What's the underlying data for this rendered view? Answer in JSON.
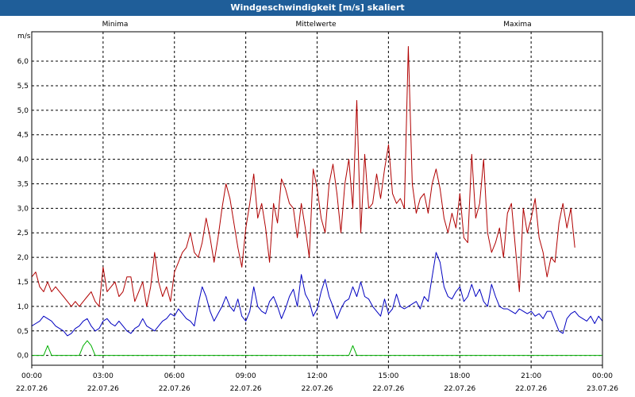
{
  "window": {
    "title": "Windgeschwindigkeit [m/s] skaliert"
  },
  "colors": {
    "min": "#00b000",
    "mean": "#0000c0",
    "max": "#b00000",
    "titlebar": "#1f5e99",
    "grid": "#000000"
  },
  "chart_data": {
    "type": "line",
    "title": "Windgeschwindigkeit [m/s] skaliert",
    "ylabel": "m/s",
    "xlabel": "",
    "ylim": [
      -0.2,
      6.6
    ],
    "xlim": [
      0,
      24
    ],
    "yticks": [
      0.0,
      0.5,
      1.0,
      1.5,
      2.0,
      2.5,
      3.0,
      3.5,
      4.0,
      4.5,
      5.0,
      5.5,
      6.0
    ],
    "ytick_labels": [
      "0,0",
      "0,5",
      "1,0",
      "1,5",
      "2,0",
      "2,5",
      "3,0",
      "3,5",
      "4,0",
      "4,5",
      "5,0",
      "5,5",
      "6,0"
    ],
    "xticks": [
      {
        "hour": 0,
        "time": "00:00",
        "date": "22.07.26"
      },
      {
        "hour": 3,
        "time": "03:00",
        "date": "22.07.26"
      },
      {
        "hour": 6,
        "time": "06:00",
        "date": "22.07.26"
      },
      {
        "hour": 9,
        "time": "09:00",
        "date": "22.07.26"
      },
      {
        "hour": 12,
        "time": "12:00",
        "date": "22.07.26"
      },
      {
        "hour": 15,
        "time": "15:00",
        "date": "22.07.26"
      },
      {
        "hour": 18,
        "time": "18:00",
        "date": "22.07.26"
      },
      {
        "hour": 21,
        "time": "21:00",
        "date": "22.07.26"
      },
      {
        "hour": 24,
        "time": "00:00",
        "date": "23.07.26"
      }
    ],
    "grid": true,
    "x_step_hours": 0.1667,
    "series": [
      {
        "name": "Minima",
        "key": "min",
        "values": [
          0.0,
          0.0,
          0.0,
          0.0,
          0.2,
          0.0,
          0.0,
          0.0,
          0.0,
          0.0,
          0.0,
          0.0,
          0.0,
          0.2,
          0.3,
          0.2,
          0.0,
          0.0,
          0.0,
          0.0,
          0.0,
          0.0,
          0.0,
          0.0,
          0.0,
          0.0,
          0.0,
          0.0,
          0.0,
          0.0,
          0.0,
          0.0,
          0.0,
          0.0,
          0.0,
          0.0,
          0.0,
          0.0,
          0.0,
          0.0,
          0.0,
          0.0,
          0.0,
          0.0,
          0.0,
          0.0,
          0.0,
          0.0,
          0.0,
          0.0,
          0.0,
          0.0,
          0.0,
          0.0,
          0.0,
          0.0,
          0.0,
          0.0,
          0.0,
          0.0,
          0.0,
          0.0,
          0.0,
          0.0,
          0.0,
          0.0,
          0.0,
          0.0,
          0.0,
          0.0,
          0.0,
          0.0,
          0.0,
          0.0,
          0.0,
          0.0,
          0.0,
          0.0,
          0.0,
          0.0,
          0.0,
          0.2,
          0.0,
          0.0,
          0.0,
          0.0,
          0.0,
          0.0,
          0.0,
          0.0,
          0.0,
          0.0,
          0.0,
          0.0,
          0.0,
          0.0,
          0.0,
          0.0,
          0.0,
          0.0,
          0.0,
          0.0,
          0.0,
          0.0,
          0.0,
          0.0,
          0.0,
          0.0,
          0.0,
          0.0,
          0.0,
          0.0,
          0.0,
          0.0,
          0.0,
          0.0,
          0.0,
          0.0,
          0.0,
          0.0,
          0.0,
          0.0,
          0.0,
          0.0,
          0.0,
          0.0,
          0.0,
          0.0,
          0.0,
          0.0,
          0.0,
          0.0,
          0.0,
          0.0,
          0.0,
          0.0,
          0.0,
          0.0,
          0.0,
          0.0,
          0.0,
          0.0,
          0.0,
          0.0,
          0.0
        ]
      },
      {
        "name": "Mittelwerte",
        "key": "mean",
        "values": [
          0.6,
          0.65,
          0.7,
          0.8,
          0.75,
          0.7,
          0.6,
          0.55,
          0.5,
          0.4,
          0.45,
          0.55,
          0.6,
          0.7,
          0.75,
          0.6,
          0.5,
          0.55,
          0.7,
          0.75,
          0.65,
          0.6,
          0.7,
          0.6,
          0.5,
          0.45,
          0.55,
          0.6,
          0.75,
          0.6,
          0.55,
          0.5,
          0.6,
          0.7,
          0.75,
          0.85,
          0.8,
          0.95,
          0.85,
          0.75,
          0.7,
          0.6,
          1.05,
          1.4,
          1.2,
          0.9,
          0.7,
          0.85,
          1.0,
          1.2,
          1.0,
          0.9,
          1.15,
          0.8,
          0.7,
          0.9,
          1.4,
          1.0,
          0.9,
          0.85,
          1.1,
          1.2,
          1.0,
          0.75,
          0.95,
          1.2,
          1.35,
          1.0,
          1.65,
          1.25,
          1.1,
          0.8,
          0.95,
          1.3,
          1.55,
          1.2,
          1.0,
          0.75,
          0.95,
          1.1,
          1.15,
          1.4,
          1.2,
          1.5,
          1.2,
          1.15,
          1.0,
          0.9,
          0.8,
          1.15,
          0.85,
          0.95,
          1.25,
          1.0,
          0.95,
          1.0,
          1.05,
          1.1,
          0.95,
          1.2,
          1.1,
          1.6,
          2.1,
          1.9,
          1.4,
          1.2,
          1.15,
          1.3,
          1.4,
          1.1,
          1.2,
          1.45,
          1.2,
          1.35,
          1.1,
          1.0,
          1.45,
          1.2,
          1.0,
          0.95,
          0.95,
          0.9,
          0.85,
          0.95,
          0.9,
          0.85,
          0.9,
          0.8,
          0.85,
          0.75,
          0.9,
          0.9,
          0.7,
          0.5,
          0.45,
          0.75,
          0.85,
          0.9,
          0.8,
          0.75,
          0.7,
          0.8,
          0.65,
          0.8,
          0.7,
          0.9,
          0.85,
          0.95,
          0.9
        ]
      },
      {
        "name": "Maxima",
        "key": "max",
        "values": [
          1.6,
          1.7,
          1.4,
          1.3,
          1.5,
          1.3,
          1.4,
          1.3,
          1.2,
          1.1,
          1.0,
          1.1,
          1.0,
          1.1,
          1.2,
          1.3,
          1.1,
          1.0,
          1.8,
          1.3,
          1.4,
          1.5,
          1.2,
          1.3,
          1.6,
          1.6,
          1.1,
          1.3,
          1.5,
          1.0,
          1.4,
          2.1,
          1.5,
          1.2,
          1.4,
          1.1,
          1.7,
          1.9,
          2.1,
          2.2,
          2.5,
          2.1,
          2.0,
          2.3,
          2.8,
          2.4,
          1.9,
          2.4,
          3.0,
          3.5,
          3.2,
          2.7,
          2.2,
          1.8,
          2.6,
          3.1,
          3.7,
          2.8,
          3.1,
          2.6,
          1.9,
          3.1,
          2.7,
          3.6,
          3.4,
          3.1,
          3.0,
          2.4,
          3.1,
          2.6,
          2.0,
          3.8,
          3.4,
          2.8,
          2.5,
          3.5,
          3.9,
          3.3,
          2.5,
          3.5,
          4.0,
          3.0,
          5.2,
          2.5,
          4.1,
          3.0,
          3.1,
          3.7,
          3.2,
          3.8,
          4.3,
          3.3,
          3.1,
          3.2,
          3.0,
          6.3,
          3.5,
          2.9,
          3.2,
          3.3,
          2.9,
          3.5,
          3.8,
          3.4,
          2.8,
          2.5,
          2.9,
          2.6,
          3.3,
          2.4,
          2.3,
          4.1,
          2.8,
          3.1,
          4.0,
          2.5,
          2.1,
          2.3,
          2.6,
          2.0,
          2.9,
          3.1,
          2.2,
          1.3,
          3.0,
          2.5,
          2.8,
          3.2,
          2.4,
          2.1,
          1.6,
          2.0,
          1.9,
          2.7,
          3.1,
          2.6,
          3.0,
          2.2
        ]
      }
    ]
  }
}
